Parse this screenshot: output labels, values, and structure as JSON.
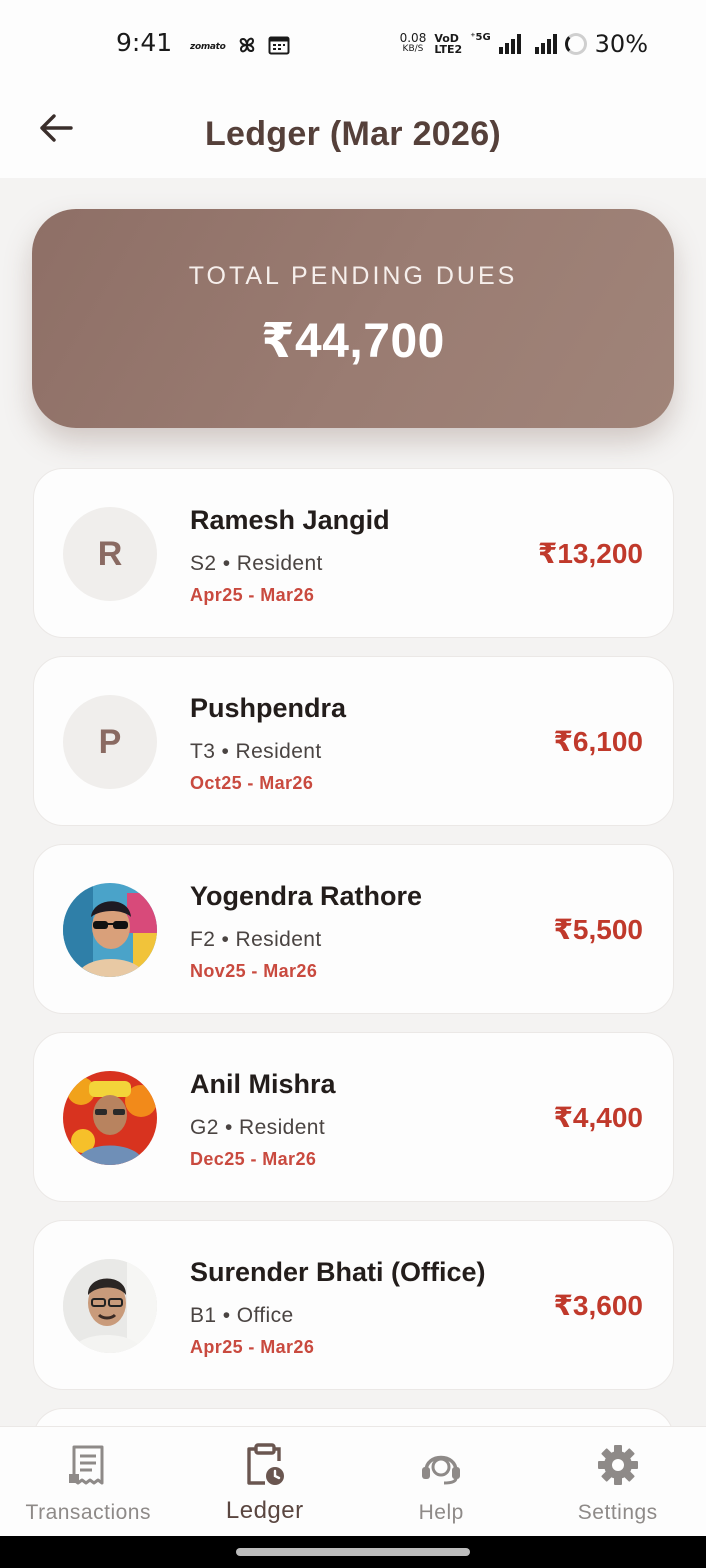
{
  "status_bar": {
    "time": "9:41",
    "app_notification": "zomato",
    "net_speed_value": "0.08",
    "net_speed_unit": "KB/S",
    "volte_top": "VoD",
    "volte_bottom": "LTE2",
    "network_5g": "⁺5G",
    "battery": "30%"
  },
  "header": {
    "title": "Ledger (Mar 2026)",
    "back_icon": "arrow-left-icon"
  },
  "summary": {
    "label": "TOTAL PENDING DUES",
    "amount": "₹44,700"
  },
  "residents": [
    {
      "initial": "R",
      "name": "Ramesh Jangid",
      "meta": "S2 • Resident",
      "period": "Apr25 - Mar26",
      "amount": "₹13,200"
    },
    {
      "initial": "P",
      "name": "Pushpendra",
      "meta": "T3 • Resident",
      "period": "Oct25 - Mar26",
      "amount": "₹6,100"
    },
    {
      "initial": "",
      "name": "Yogendra Rathore",
      "meta": "F2 • Resident",
      "period": "Nov25 - Mar26",
      "amount": "₹5,500"
    },
    {
      "initial": "",
      "name": "Anil Mishra",
      "meta": "G2 • Resident",
      "period": "Dec25 - Mar26",
      "amount": "₹4,400"
    },
    {
      "initial": "",
      "name": "Surender Bhati (Office)",
      "meta": "B1 • Office",
      "period": "Apr25 - Mar26",
      "amount": "₹3,600"
    }
  ],
  "bottom_nav": [
    {
      "label": "Transactions",
      "icon": "receipt-icon",
      "active": false
    },
    {
      "label": "Ledger",
      "icon": "clipboard-clock-icon",
      "active": true
    },
    {
      "label": "Help",
      "icon": "headset-icon",
      "active": false
    },
    {
      "label": "Settings",
      "icon": "gear-icon",
      "active": false
    }
  ],
  "colors": {
    "brand": "#8e6f66",
    "title": "#55403a",
    "amount_due": "#c0392b",
    "period_red": "#c94a3f"
  }
}
